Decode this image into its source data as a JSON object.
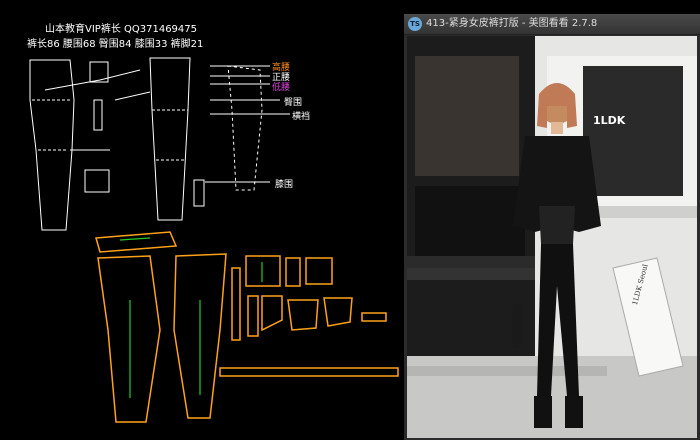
{
  "cad": {
    "header_line1": "山本教育VIP裤长    QQ371469475",
    "header_line2": "裤长86   腰围68   臀围84   膝围33   裤脚21",
    "labels": {
      "high_waist": "高腰",
      "normal_waist": "正腰",
      "low_waist": "低腰",
      "hip": "臀围",
      "crotch": "横裆",
      "knee": "膝围"
    },
    "label_colors": {
      "high_waist": "#ff8c1a",
      "normal_waist": "#ffffff",
      "low_waist": "#e040e0",
      "other": "#ffffff",
      "pattern_outline": "#ffa21a",
      "grain_line": "#22cc22"
    }
  },
  "viewer": {
    "app_icon": "TS",
    "window_title": "413-紧身女皮裤打版 - 美图看看 2.7.8",
    "store_sign": "1LDK",
    "poster_text": "1LDK Seoul"
  }
}
